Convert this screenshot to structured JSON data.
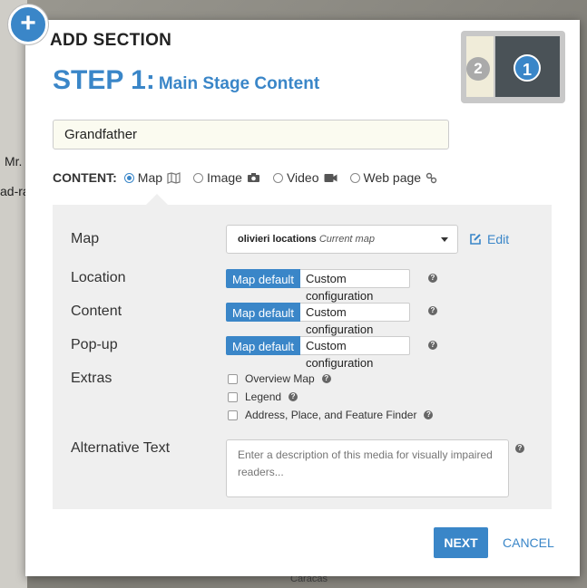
{
  "background": {
    "snippets": [
      "Mr.",
      "ad-ra"
    ],
    "map_label": "Caracas"
  },
  "dialog": {
    "title": "ADD SECTION",
    "step_number": "STEP 1:",
    "step_name": "Main Stage Content",
    "section_title_value": "Grandfather",
    "layout_thumbs": [
      "2",
      "1"
    ]
  },
  "content": {
    "label": "CONTENT:",
    "options": [
      {
        "label": "Map",
        "icon": "map-icon",
        "selected": true
      },
      {
        "label": "Image",
        "icon": "camera-icon",
        "selected": false
      },
      {
        "label": "Video",
        "icon": "video-camera-icon",
        "selected": false
      },
      {
        "label": "Web page",
        "icon": "link-icon",
        "selected": false
      }
    ]
  },
  "map_settings": {
    "map_label": "Map",
    "map_select_name": "olivieri locations",
    "map_select_note": "Current map",
    "edit_label": "Edit",
    "location_label": "Location",
    "content_label": "Content",
    "popup_label": "Pop-up",
    "default_label": "Map default",
    "custom_label": "Custom configuration",
    "extras_label": "Extras",
    "extras": [
      "Overview Map",
      "Legend",
      "Address, Place, and Feature Finder"
    ],
    "alt_text_label": "Alternative Text",
    "alt_text_placeholder": "Enter a description of this media for visually impaired readers..."
  },
  "footer": {
    "next_label": "NEXT",
    "cancel_label": "CANCEL"
  },
  "colors": {
    "accent": "#3a86c8",
    "panel": "#efefef"
  }
}
